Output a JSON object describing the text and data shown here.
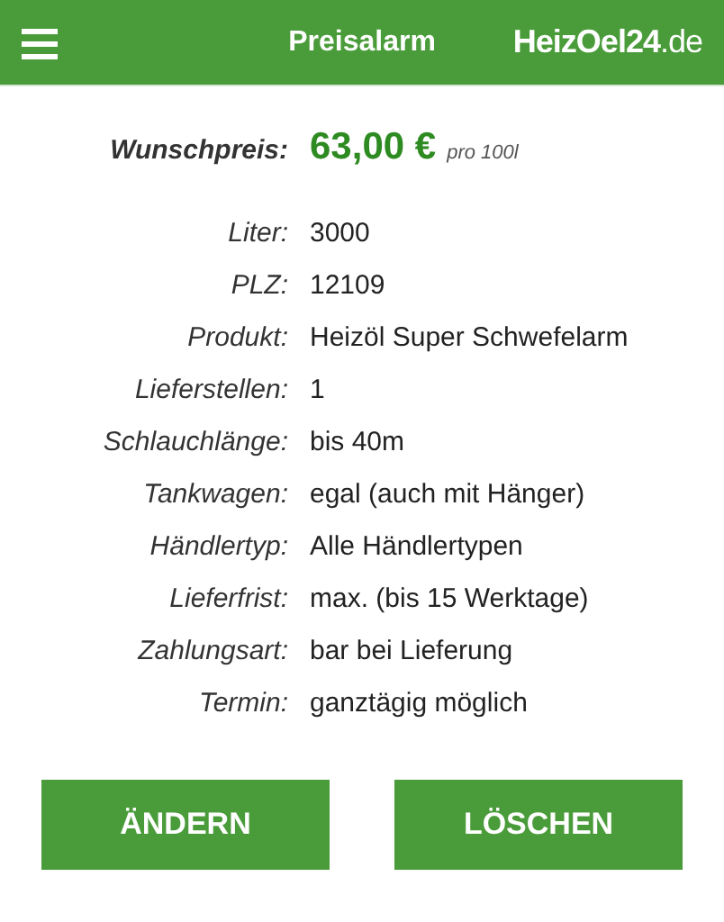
{
  "header": {
    "title": "Preisalarm",
    "logo": "**HeizOel24**.de"
  },
  "price": {
    "label": "Wunschpreis:",
    "value": "63,00 €",
    "unit": "pro 100l"
  },
  "details": [
    {
      "label": "Liter:",
      "value": "3000"
    },
    {
      "label": "PLZ:",
      "value": "12109"
    },
    {
      "label": "Produkt:",
      "value": "Heizöl Super Schwefelarm"
    },
    {
      "label": "Lieferstellen:",
      "value": "1"
    },
    {
      "label": "Schlauchlänge:",
      "value": "bis 40m"
    },
    {
      "label": "Tankwagen:",
      "value": "egal (auch mit Hänger)"
    },
    {
      "label": "Händlertyp:",
      "value": "Alle Händlertypen"
    },
    {
      "label": "Lieferfrist:",
      "value": "max. (bis 15 Werktage)"
    },
    {
      "label": "Zahlungsart:",
      "value": "bar bei Lieferung"
    },
    {
      "label": "Termin:",
      "value": "ganztägig möglich"
    }
  ],
  "buttons": [
    "ÄNDERN",
    "LÖSCHEN"
  ]
}
